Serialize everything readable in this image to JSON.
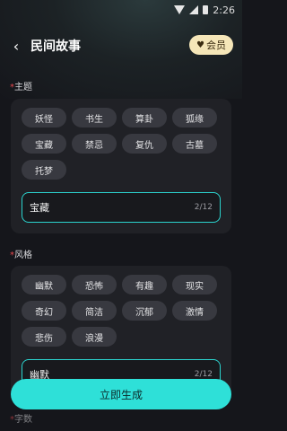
{
  "status_bar": {
    "time": "2:26"
  },
  "header": {
    "back_icon": "‹",
    "title": "民间故事",
    "vip_label": "会员",
    "vip_icon": "♥"
  },
  "theme": {
    "required_mark": "*",
    "label": "主题",
    "chips": [
      "妖怪",
      "书生",
      "算卦",
      "狐缘",
      "宝藏",
      "禁忌",
      "复仇",
      "古墓",
      "托梦"
    ],
    "input_value": "宝藏",
    "input_count": "2/12"
  },
  "style": {
    "required_mark": "*",
    "label": "风格",
    "chips": [
      "幽默",
      "恐怖",
      "有趣",
      "现实",
      "奇幻",
      "简洁",
      "沉郁",
      "激情",
      "悲伤",
      "浪漫"
    ],
    "input_value": "幽默",
    "input_count": "2/12"
  },
  "word_count": {
    "required_mark": "*",
    "label": "字数"
  },
  "generate_button": {
    "label": "立即生成"
  },
  "colors": {
    "accent": "#2ee0d8",
    "vip": "#f5e6b8",
    "required": "#e5484d"
  }
}
